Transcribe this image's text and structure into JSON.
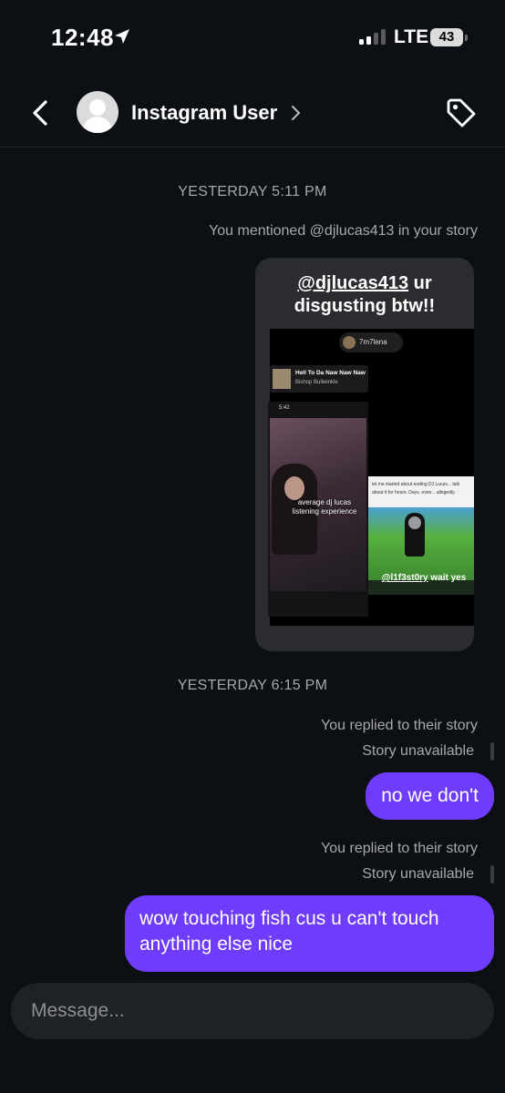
{
  "status_bar": {
    "time": "12:48",
    "network": "LTE",
    "battery": "43",
    "location_icon": "location-arrow-icon",
    "signal_bars": 2,
    "signal_max": 4
  },
  "header": {
    "contact_name": "Instagram User",
    "back_icon": "chevron-left-icon",
    "name_chevron_icon": "chevron-right-icon",
    "tag_icon": "tag-icon"
  },
  "thread": {
    "timestamp_1": "YESTERDAY 5:11 PM",
    "mention_notice": "You mentioned @djlucas413 in your story",
    "story": {
      "caption_mention": "@djlucas413",
      "caption_rest_1": " ur",
      "caption_line_2": "disgusting btw!!",
      "tag_user": "7m7lena",
      "music_title": "Hell To Da Naw Naw Naw",
      "music_artist": "Bishop Bullwinkle",
      "phone_clock": "5:42",
      "video_caption": "average dj lucas listening experience",
      "game_text": "let me started about ending DJ Lucas... talk about it for hours. Days. even... allegedly.",
      "game_caption_mention": "@l1f3st0ry",
      "game_caption_rest": " wait yes"
    },
    "timestamp_2": "YESTERDAY 6:15 PM",
    "replies": [
      {
        "notice": "You replied to their story",
        "status": "Story unavailable",
        "message": "no we don't"
      },
      {
        "notice": "You replied to their story",
        "status": "Story unavailable",
        "message": "wow touching fish cus u can't touch anything else nice"
      }
    ]
  },
  "composer": {
    "placeholder": "Message..."
  },
  "colors": {
    "background": "#0c1014",
    "bubble": "#6e3cfa",
    "meta_text": "#a8a8a8",
    "composer_bg": "#1e2125"
  }
}
